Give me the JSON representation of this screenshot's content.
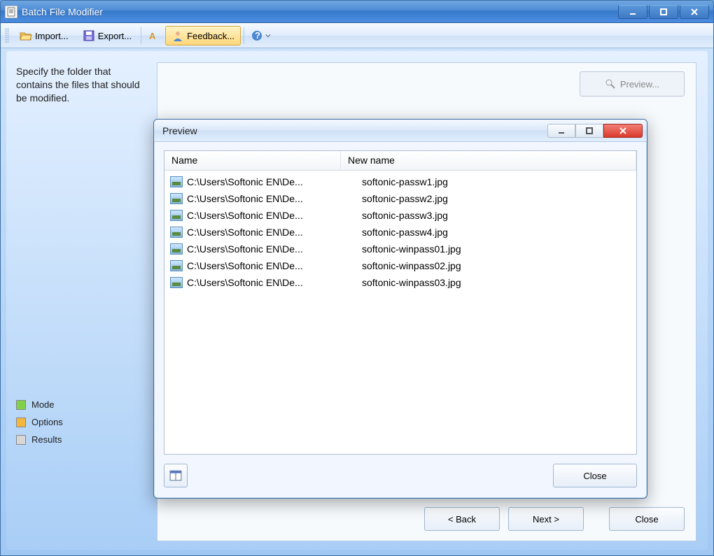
{
  "window": {
    "title": "Batch File Modifier"
  },
  "toolbar": {
    "import_label": "Import...",
    "export_label": "Export...",
    "feedback_label": "Feedback..."
  },
  "left": {
    "hint": "Specify the folder that contains the files that should be modified.",
    "nav": [
      {
        "label": "Mode",
        "color": "green"
      },
      {
        "label": "Options",
        "color": "orange"
      },
      {
        "label": "Results",
        "color": "grey"
      }
    ]
  },
  "content": {
    "preview_button": "Preview..."
  },
  "footer": {
    "back": "< Back",
    "next": "Next >",
    "close": "Close"
  },
  "dialog": {
    "title": "Preview",
    "columns": {
      "name": "Name",
      "new": "New name"
    },
    "rows": [
      {
        "name": "C:\\Users\\Softonic EN\\De...",
        "new": "softonic-passw1.jpg"
      },
      {
        "name": "C:\\Users\\Softonic EN\\De...",
        "new": "softonic-passw2.jpg"
      },
      {
        "name": "C:\\Users\\Softonic EN\\De...",
        "new": "softonic-passw3.jpg"
      },
      {
        "name": "C:\\Users\\Softonic EN\\De...",
        "new": "softonic-passw4.jpg"
      },
      {
        "name": "C:\\Users\\Softonic EN\\De...",
        "new": "softonic-winpass01.jpg"
      },
      {
        "name": "C:\\Users\\Softonic EN\\De...",
        "new": "softonic-winpass02.jpg"
      },
      {
        "name": "C:\\Users\\Softonic EN\\De...",
        "new": "softonic-winpass03.jpg"
      }
    ],
    "close": "Close"
  }
}
